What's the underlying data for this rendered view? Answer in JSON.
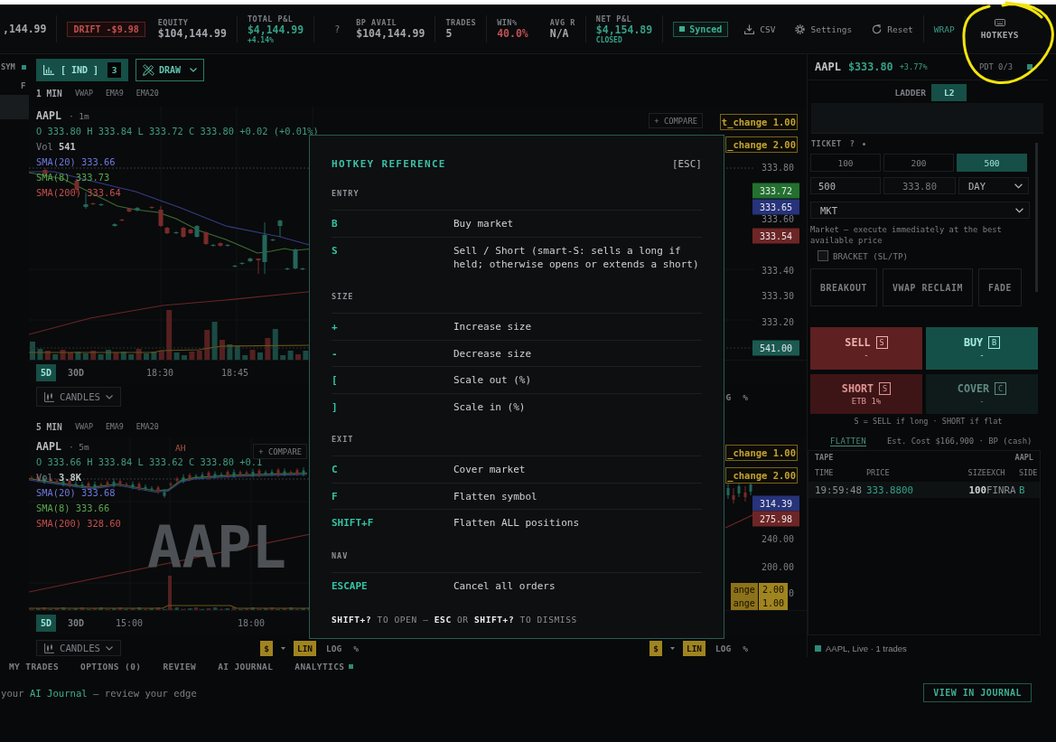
{
  "top_bar": {
    "groups": [
      [
        {
          "kind": "value",
          "value": ",144.99"
        }
      ],
      [
        {
          "kind": "badge",
          "text": "DRIFT -$9.98"
        },
        {
          "kind": "stat",
          "label": "EQUITY",
          "value": "$104,144.99",
          "color": "#a4a8ac"
        }
      ],
      [
        {
          "kind": "stat",
          "label": "TOTAL P&L",
          "value": "$4,144.99",
          "sub": "+4.14%",
          "color": "#35a088"
        }
      ],
      [
        {
          "kind": "help",
          "text": "?"
        },
        {
          "kind": "stat",
          "label": "BP AVAIL",
          "value": "$104,144.99",
          "color": "#a4a8ac"
        }
      ],
      [
        {
          "kind": "stat",
          "label": "TRADES",
          "value": "5",
          "color": "#a4a8ac"
        }
      ],
      [
        {
          "kind": "stat",
          "label": "WIN%",
          "value": "40.0%",
          "color": "#c25050"
        },
        {
          "kind": "stat",
          "label": "AVG R",
          "value": "N/A",
          "color": "#a4a8ac"
        }
      ],
      [
        {
          "kind": "stat",
          "label": "NET P&L",
          "value": "$4,154.89",
          "sub": "CLOSED",
          "color": "#35a088"
        }
      ],
      [
        {
          "kind": "status",
          "text": "Synced"
        },
        {
          "kind": "export",
          "text": "CSV"
        },
        {
          "kind": "settings",
          "text": "Settings"
        },
        {
          "kind": "reset",
          "text": "Reset"
        }
      ],
      [
        {
          "kind": "toggle",
          "text": "WRAP"
        }
      ],
      [
        {
          "kind": "hotkeys",
          "text": "HOTKEYS"
        }
      ]
    ]
  },
  "left_strip": {
    "label": "SYM",
    "column": "F"
  },
  "chart_toolbar": {
    "indicators": {
      "label": "[ IND ]",
      "count": "3"
    },
    "draw": {
      "label": "DRAW"
    }
  },
  "chart_rows": [
    {
      "timeframe": "1 MIN",
      "studies": [
        "VWAP",
        "EMA9",
        "EMA20"
      ],
      "panels": [
        {
          "legend": {
            "symbol": "AAPL",
            "interval": "· 1m",
            "ohlc": "O 333.80 H 333.84 L 333.72 C 333.80 +0.02 (+0.01%)",
            "volume": "Vol **541**",
            "averages": [
              {
                "text": "SMA(20) 333.66",
                "color": "#6d78dc"
              },
              {
                "text": "SMA(8) 333.73",
                "color": "#5aa651"
              },
              {
                "text": "SMA(200) 333.64",
                "color": "#c44e4e"
              }
            ]
          },
          "compare": "+ COMPARE",
          "tags": [
            "t_change 1.00",
            "_change 2.00"
          ],
          "axis_labels": [
            {
              "text": "333.80",
              "kind": "tick"
            },
            {
              "text": "333.72",
              "kind": "marker",
              "color": "#23702f"
            },
            {
              "text": "333.65",
              "kind": "marker",
              "color": "#27337a"
            },
            {
              "text": "333.60",
              "kind": "tick"
            },
            {
              "text": "333.54",
              "kind": "marker",
              "color": "#6e2525"
            },
            {
              "text": "333.40",
              "kind": "tick"
            },
            {
              "text": "333.30",
              "kind": "tick"
            },
            {
              "text": "333.20",
              "kind": "tick"
            },
            {
              "text": "541.00",
              "kind": "marker",
              "color": "#1a5a51"
            }
          ],
          "ranges": [
            {
              "label": "5D",
              "selected": true
            },
            {
              "label": "30D",
              "selected": false
            }
          ],
          "times": [
            "18:30",
            "18:45"
          ],
          "chart_type": "CANDLES",
          "scale": [
            {
              "label": "G",
              "selected": false,
              "dropdown": false
            },
            {
              "label": "%",
              "selected": false,
              "dropdown": false
            }
          ]
        }
      ]
    },
    {
      "timeframe": "5 MIN",
      "studies": [
        "VWAP",
        "EMA9",
        "EMA20"
      ],
      "panels": [
        {
          "legend": {
            "symbol": "AAPL",
            "interval": "· 5m",
            "ohlc": "O 333.66 H 333.84 L 333.62 C 333.80 +0.1",
            "volume": "Vol **3.8K**",
            "averages": [
              {
                "text": "SMA(20) 333.68",
                "color": "#6d78dc"
              },
              {
                "text": "SMA(8) 333.66",
                "color": "#5aa651"
              },
              {
                "text": "SMA(200) 328.60",
                "color": "#c44e4e"
              }
            ]
          },
          "session_label": "AH",
          "watermark": "AAPL",
          "compare": "+ COMPARE",
          "ranges": [
            {
              "label": "5D",
              "selected": true
            },
            {
              "label": "30D",
              "selected": false
            }
          ],
          "times": [
            "15:00",
            "18:00"
          ],
          "chart_type": "CANDLES",
          "scale": [
            {
              "label": "$",
              "selected": true,
              "dropdown": true
            },
            {
              "label": "LIN",
              "selected": true,
              "dropdown": false
            },
            {
              "label": "LOG",
              "selected": false,
              "dropdown": false
            },
            {
              "label": "%",
              "selected": false,
              "dropdown": false
            }
          ]
        },
        {
          "tags": [
            "_change 1.00",
            "_change 2.00"
          ],
          "axis_labels": [
            {
              "text": "314.39",
              "kind": "marker",
              "color": "#27337a"
            },
            {
              "text": "275.98",
              "kind": "marker",
              "color": "#6e2525"
            },
            {
              "text": "240.00",
              "kind": "tick"
            },
            {
              "text": "200.00",
              "kind": "tick"
            },
            {
              "text": "0",
              "kind": "tick"
            }
          ],
          "bottom_tags": [
            {
              "label": "ange",
              "value": "2.00"
            },
            {
              "label": "ange",
              "value": "1.00"
            }
          ],
          "scale": [
            {
              "label": "$",
              "selected": true,
              "dropdown": true
            },
            {
              "label": "LIN",
              "selected": true,
              "dropdown": false
            },
            {
              "label": "LOG",
              "selected": false,
              "dropdown": false
            },
            {
              "label": "%",
              "selected": false,
              "dropdown": false
            }
          ]
        }
      ]
    }
  ],
  "order_panel": {
    "header": {
      "symbol": "AAPL",
      "price": "$333.80",
      "change": "+3.77%",
      "pdt": "PDT 0/3"
    },
    "views": [
      {
        "label": "LADDER",
        "selected": false
      },
      {
        "label": "L2",
        "selected": true
      }
    ],
    "ticket": {
      "title": "TICKET",
      "help": "?"
    },
    "sizes": [
      {
        "label": "100",
        "selected": false
      },
      {
        "label": "200",
        "selected": false
      },
      {
        "label": "500",
        "selected": true
      }
    ],
    "fields": [
      {
        "kind": "input",
        "value": "500"
      },
      {
        "kind": "input",
        "placeholder": "333.80"
      },
      {
        "kind": "select",
        "value": "DAY"
      }
    ],
    "order_type": "MKT",
    "description": "Market — execute immediately at the best available price",
    "bracket": {
      "label": "BRACKET (SL/TP)",
      "checked": false
    },
    "setups": [
      "BREAKOUT",
      "VWAP RECLAIM",
      "FADE"
    ],
    "actions": [
      {
        "kind": "sell",
        "label": "SELL",
        "key": "S",
        "sub": "-",
        "disabled": false
      },
      {
        "kind": "buy",
        "label": "BUY",
        "key": "B",
        "sub": "-",
        "disabled": false
      },
      {
        "kind": "short",
        "label": "SHORT",
        "key": "S",
        "sub": "ETB 1%",
        "disabled": false
      },
      {
        "kind": "cover",
        "label": "COVER",
        "key": "C",
        "sub": "-",
        "disabled": true
      }
    ],
    "hint": "S = SELL if long · SHORT if flat",
    "flatten": {
      "label": "FLATTEN",
      "disabled": true
    },
    "estimate": "Est. Cost $166,900 · BP (cash)",
    "tape": {
      "title": "TAPE",
      "symbol": "AAPL",
      "columns": [
        "TIME",
        "PRICE",
        "SIZE",
        "EXCH",
        "SIDE"
      ],
      "rows": [
        [
          "19:59:48",
          "333.8800",
          "100",
          "FINRA",
          "B"
        ]
      ]
    },
    "status": "AAPL, Live · 1 trades"
  },
  "bottom_tabs": [
    {
      "label": "MY TRADES",
      "selected": false,
      "dot": false
    },
    {
      "label": "OPTIONS (0)",
      "selected": false,
      "dot": false
    },
    {
      "label": "REVIEW",
      "selected": false,
      "dot": false
    },
    {
      "label": "AI JOURNAL",
      "selected": false,
      "dot": false
    },
    {
      "label": "ANALYTICS",
      "selected": false,
      "dot": true
    }
  ],
  "journal_prompt": {
    "before": "your ",
    "link": "AI Journal",
    "after": " — review your edge",
    "button": "VIEW IN JOURNAL"
  },
  "hotkey_modal": {
    "title": "HOTKEY REFERENCE",
    "close_hint": "[ESC]",
    "sections": [
      {
        "title": "ENTRY",
        "rows": [
          {
            "key": "B",
            "action": "Buy market"
          },
          {
            "key": "S",
            "action": "Sell / Short (smart-S: sells a long if held; otherwise opens or extends a short)"
          }
        ]
      },
      {
        "title": "SIZE",
        "rows": [
          {
            "key": "+",
            "action": "Increase size"
          },
          {
            "key": "-",
            "action": "Decrease size"
          },
          {
            "key": "[",
            "action": "Scale out (%)"
          },
          {
            "key": "]",
            "action": "Scale in (%)"
          }
        ]
      },
      {
        "title": "EXIT",
        "rows": [
          {
            "key": "C",
            "action": "Cover market"
          },
          {
            "key": "F",
            "action": "Flatten symbol"
          },
          {
            "key": "SHIFT+F",
            "action": "Flatten ALL positions"
          }
        ]
      },
      {
        "title": "NAV",
        "rows": [
          {
            "key": "ESCAPE",
            "action": "Cancel all orders"
          }
        ]
      }
    ],
    "footer": "**SHIFT+?** TO OPEN — **ESC** OR **SHIFT+?** TO DISMISS"
  },
  "annotation": {
    "kind": "circle"
  }
}
